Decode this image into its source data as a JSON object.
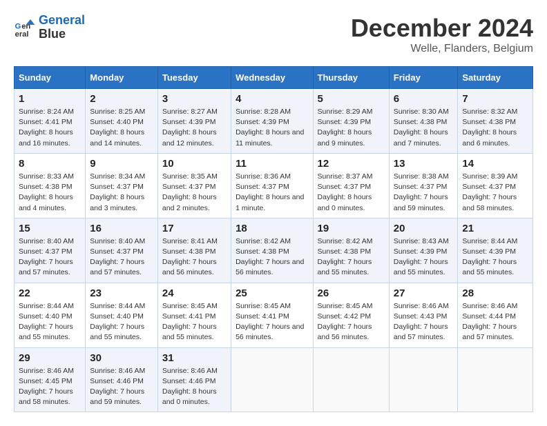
{
  "header": {
    "logo_line1": "General",
    "logo_line2": "Blue",
    "month": "December 2024",
    "location": "Welle, Flanders, Belgium"
  },
  "days_of_week": [
    "Sunday",
    "Monday",
    "Tuesday",
    "Wednesday",
    "Thursday",
    "Friday",
    "Saturday"
  ],
  "weeks": [
    [
      {
        "day": "1",
        "sunrise": "8:24 AM",
        "sunset": "4:41 PM",
        "daylight": "8 hours and 16 minutes."
      },
      {
        "day": "2",
        "sunrise": "8:25 AM",
        "sunset": "4:40 PM",
        "daylight": "8 hours and 14 minutes."
      },
      {
        "day": "3",
        "sunrise": "8:27 AM",
        "sunset": "4:39 PM",
        "daylight": "8 hours and 12 minutes."
      },
      {
        "day": "4",
        "sunrise": "8:28 AM",
        "sunset": "4:39 PM",
        "daylight": "8 hours and 11 minutes."
      },
      {
        "day": "5",
        "sunrise": "8:29 AM",
        "sunset": "4:39 PM",
        "daylight": "8 hours and 9 minutes."
      },
      {
        "day": "6",
        "sunrise": "8:30 AM",
        "sunset": "4:38 PM",
        "daylight": "8 hours and 7 minutes."
      },
      {
        "day": "7",
        "sunrise": "8:32 AM",
        "sunset": "4:38 PM",
        "daylight": "8 hours and 6 minutes."
      }
    ],
    [
      {
        "day": "8",
        "sunrise": "8:33 AM",
        "sunset": "4:38 PM",
        "daylight": "8 hours and 4 minutes."
      },
      {
        "day": "9",
        "sunrise": "8:34 AM",
        "sunset": "4:37 PM",
        "daylight": "8 hours and 3 minutes."
      },
      {
        "day": "10",
        "sunrise": "8:35 AM",
        "sunset": "4:37 PM",
        "daylight": "8 hours and 2 minutes."
      },
      {
        "day": "11",
        "sunrise": "8:36 AM",
        "sunset": "4:37 PM",
        "daylight": "8 hours and 1 minute."
      },
      {
        "day": "12",
        "sunrise": "8:37 AM",
        "sunset": "4:37 PM",
        "daylight": "8 hours and 0 minutes."
      },
      {
        "day": "13",
        "sunrise": "8:38 AM",
        "sunset": "4:37 PM",
        "daylight": "7 hours and 59 minutes."
      },
      {
        "day": "14",
        "sunrise": "8:39 AM",
        "sunset": "4:37 PM",
        "daylight": "7 hours and 58 minutes."
      }
    ],
    [
      {
        "day": "15",
        "sunrise": "8:40 AM",
        "sunset": "4:37 PM",
        "daylight": "7 hours and 57 minutes."
      },
      {
        "day": "16",
        "sunrise": "8:40 AM",
        "sunset": "4:37 PM",
        "daylight": "7 hours and 57 minutes."
      },
      {
        "day": "17",
        "sunrise": "8:41 AM",
        "sunset": "4:38 PM",
        "daylight": "7 hours and 56 minutes."
      },
      {
        "day": "18",
        "sunrise": "8:42 AM",
        "sunset": "4:38 PM",
        "daylight": "7 hours and 56 minutes."
      },
      {
        "day": "19",
        "sunrise": "8:42 AM",
        "sunset": "4:38 PM",
        "daylight": "7 hours and 55 minutes."
      },
      {
        "day": "20",
        "sunrise": "8:43 AM",
        "sunset": "4:39 PM",
        "daylight": "7 hours and 55 minutes."
      },
      {
        "day": "21",
        "sunrise": "8:44 AM",
        "sunset": "4:39 PM",
        "daylight": "7 hours and 55 minutes."
      }
    ],
    [
      {
        "day": "22",
        "sunrise": "8:44 AM",
        "sunset": "4:40 PM",
        "daylight": "7 hours and 55 minutes."
      },
      {
        "day": "23",
        "sunrise": "8:44 AM",
        "sunset": "4:40 PM",
        "daylight": "7 hours and 55 minutes."
      },
      {
        "day": "24",
        "sunrise": "8:45 AM",
        "sunset": "4:41 PM",
        "daylight": "7 hours and 55 minutes."
      },
      {
        "day": "25",
        "sunrise": "8:45 AM",
        "sunset": "4:41 PM",
        "daylight": "7 hours and 56 minutes."
      },
      {
        "day": "26",
        "sunrise": "8:45 AM",
        "sunset": "4:42 PM",
        "daylight": "7 hours and 56 minutes."
      },
      {
        "day": "27",
        "sunrise": "8:46 AM",
        "sunset": "4:43 PM",
        "daylight": "7 hours and 57 minutes."
      },
      {
        "day": "28",
        "sunrise": "8:46 AM",
        "sunset": "4:44 PM",
        "daylight": "7 hours and 57 minutes."
      }
    ],
    [
      {
        "day": "29",
        "sunrise": "8:46 AM",
        "sunset": "4:45 PM",
        "daylight": "7 hours and 58 minutes."
      },
      {
        "day": "30",
        "sunrise": "8:46 AM",
        "sunset": "4:46 PM",
        "daylight": "7 hours and 59 minutes."
      },
      {
        "day": "31",
        "sunrise": "8:46 AM",
        "sunset": "4:46 PM",
        "daylight": "8 hours and 0 minutes."
      },
      null,
      null,
      null,
      null
    ]
  ]
}
